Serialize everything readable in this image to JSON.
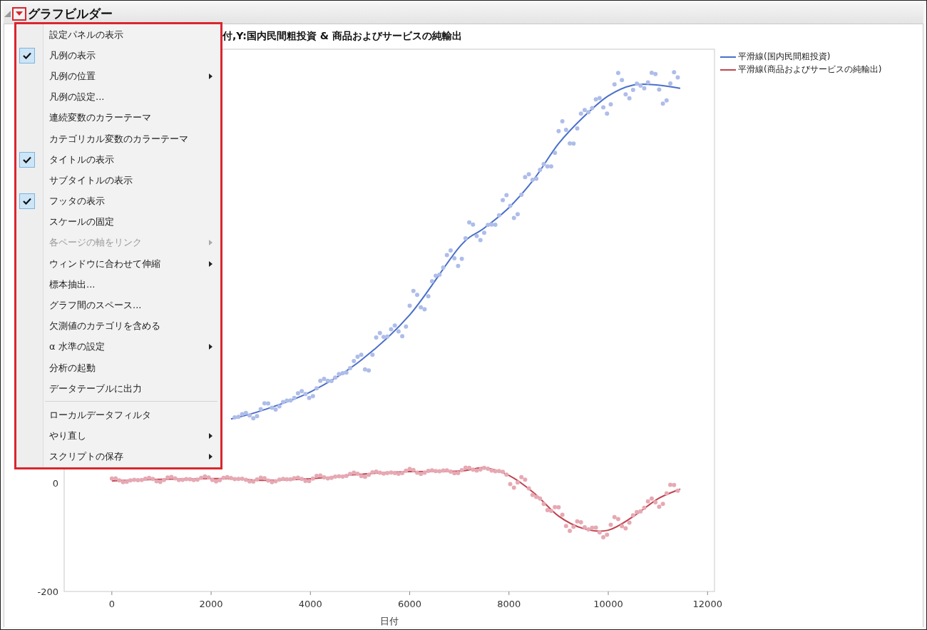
{
  "header": {
    "title": "グラフビルダー"
  },
  "menu": {
    "sections": [
      [
        {
          "label": "設定パネルの表示",
          "checked": false,
          "disabled": false,
          "submenu": false
        },
        {
          "label": "凡例の表示",
          "checked": true,
          "disabled": false,
          "submenu": false
        },
        {
          "label": "凡例の位置",
          "checked": false,
          "disabled": false,
          "submenu": true
        },
        {
          "label": "凡例の設定...",
          "checked": false,
          "disabled": false,
          "submenu": false
        },
        {
          "label": "連続変数のカラーテーマ",
          "checked": false,
          "disabled": false,
          "submenu": false
        },
        {
          "label": "カテゴリカル変数のカラーテーマ",
          "checked": false,
          "disabled": false,
          "submenu": false
        },
        {
          "label": "タイトルの表示",
          "checked": true,
          "disabled": false,
          "submenu": false
        },
        {
          "label": "サブタイトルの表示",
          "checked": false,
          "disabled": false,
          "submenu": false
        },
        {
          "label": "フッタの表示",
          "checked": true,
          "disabled": false,
          "submenu": false
        },
        {
          "label": "スケールの固定",
          "checked": false,
          "disabled": false,
          "submenu": false
        },
        {
          "label": "各ページの軸をリンク",
          "checked": false,
          "disabled": true,
          "submenu": true
        },
        {
          "label": "ウィンドウに合わせて伸縮",
          "checked": false,
          "disabled": false,
          "submenu": true
        },
        {
          "label": "標本抽出...",
          "checked": false,
          "disabled": false,
          "submenu": false
        },
        {
          "label": "グラフ間のスペース...",
          "checked": false,
          "disabled": false,
          "submenu": false
        },
        {
          "label": "欠測値のカテゴリを含める",
          "checked": false,
          "disabled": false,
          "submenu": false
        },
        {
          "label": "α 水準の設定",
          "checked": false,
          "disabled": false,
          "submenu": true
        },
        {
          "label": "分析の起動",
          "checked": false,
          "disabled": false,
          "submenu": false
        },
        {
          "label": "データテーブルに出力",
          "checked": false,
          "disabled": false,
          "submenu": false
        }
      ],
      [
        {
          "label": "ローカルデータフィルタ",
          "checked": false,
          "disabled": false,
          "submenu": false
        },
        {
          "label": "やり直し",
          "checked": false,
          "disabled": false,
          "submenu": true
        },
        {
          "label": "スクリプトの保存",
          "checked": false,
          "disabled": false,
          "submenu": true
        }
      ]
    ]
  },
  "graph": {
    "title": "付,Y:国内民間粗投資 & 商品およびサービスの純輸出",
    "chart_data": {
      "type": "line",
      "xlabel": "日付",
      "x": [
        0,
        1000,
        2400,
        3000,
        4000,
        5000,
        6000,
        7000,
        7500,
        8000,
        8500,
        9000,
        9500,
        10000,
        10500,
        11000,
        11450
      ],
      "series": [
        {
          "name": "平滑線(国内民間粗投資)",
          "color": "#4a6fc9",
          "values": [
            null,
            null,
            118,
            133,
            168,
            225,
            310,
            435,
            470,
            508,
            560,
            626,
            675,
            714,
            734,
            734,
            728
          ]
        },
        {
          "name": "平滑線(商品およびサービスの純輸出)",
          "color": "#c0434f",
          "values": [
            4,
            7,
            8,
            5,
            8,
            16,
            21,
            22,
            28,
            14,
            -18,
            -61,
            -84,
            -87,
            -62,
            -29,
            -11
          ]
        }
      ],
      "xlim": [
        -960,
        12140
      ],
      "ylim": [
        -200,
        800
      ],
      "xticks": [
        0,
        2000,
        4000,
        6000,
        8000,
        10000,
        12000
      ],
      "yticks": [
        0,
        -200
      ]
    }
  }
}
